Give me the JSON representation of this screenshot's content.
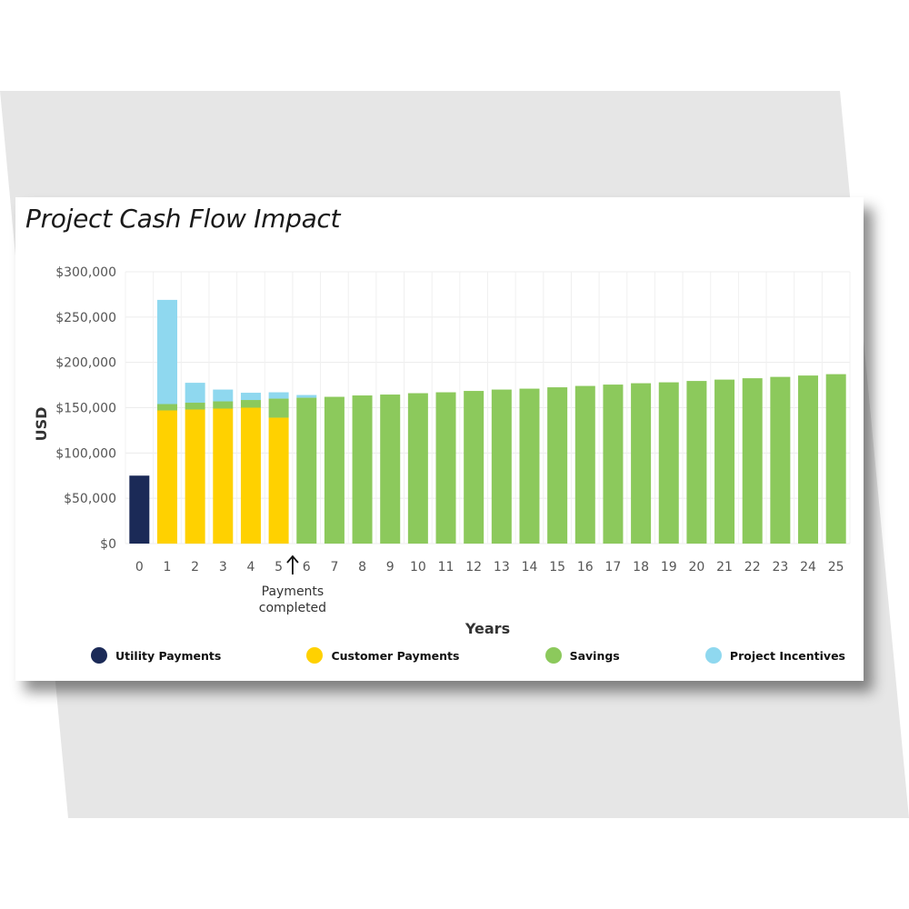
{
  "chart_data": {
    "type": "bar",
    "stacked": true,
    "title": "Project Cash Flow Impact",
    "xlabel": "Years",
    "ylabel": "USD",
    "ylim": [
      0,
      300000
    ],
    "yticks": [
      0,
      50000,
      100000,
      150000,
      200000,
      250000,
      300000
    ],
    "ytick_labels": [
      "$0",
      "$50,000",
      "$100,000",
      "$150,000",
      "$200,000",
      "$250,000",
      "$300,000"
    ],
    "categories": [
      "0",
      "1",
      "2",
      "3",
      "4",
      "5",
      "6",
      "7",
      "8",
      "9",
      "10",
      "11",
      "12",
      "13",
      "14",
      "15",
      "16",
      "17",
      "18",
      "19",
      "20",
      "21",
      "22",
      "23",
      "24",
      "25"
    ],
    "grid": true,
    "legend_position": "bottom",
    "series": [
      {
        "name": "Utility Payments",
        "color": "#1b2a57",
        "values": [
          75000,
          0,
          0,
          0,
          0,
          0,
          0,
          0,
          0,
          0,
          0,
          0,
          0,
          0,
          0,
          0,
          0,
          0,
          0,
          0,
          0,
          0,
          0,
          0,
          0,
          0
        ]
      },
      {
        "name": "Customer Payments",
        "color": "#ffd100",
        "values": [
          0,
          147000,
          148000,
          149000,
          150000,
          139000,
          0,
          0,
          0,
          0,
          0,
          0,
          0,
          0,
          0,
          0,
          0,
          0,
          0,
          0,
          0,
          0,
          0,
          0,
          0,
          0
        ]
      },
      {
        "name": "Savings",
        "color": "#8cc95c",
        "values": [
          0,
          7000,
          7500,
          8000,
          8500,
          21000,
          161000,
          162000,
          163500,
          164500,
          166000,
          167000,
          168500,
          170000,
          171000,
          172500,
          174000,
          175500,
          177000,
          178000,
          179500,
          181000,
          182500,
          184000,
          185500,
          187000
        ]
      },
      {
        "name": "Project Incentives",
        "color": "#8fd8ef",
        "values": [
          0,
          115000,
          22000,
          13000,
          8000,
          7000,
          3000,
          0,
          0,
          0,
          0,
          0,
          0,
          0,
          0,
          0,
          0,
          0,
          0,
          0,
          0,
          0,
          0,
          0,
          0,
          0
        ]
      }
    ],
    "annotations": [
      {
        "text_lines": [
          "Payments",
          "completed"
        ],
        "arrow": "up",
        "at_category": "5"
      }
    ]
  }
}
